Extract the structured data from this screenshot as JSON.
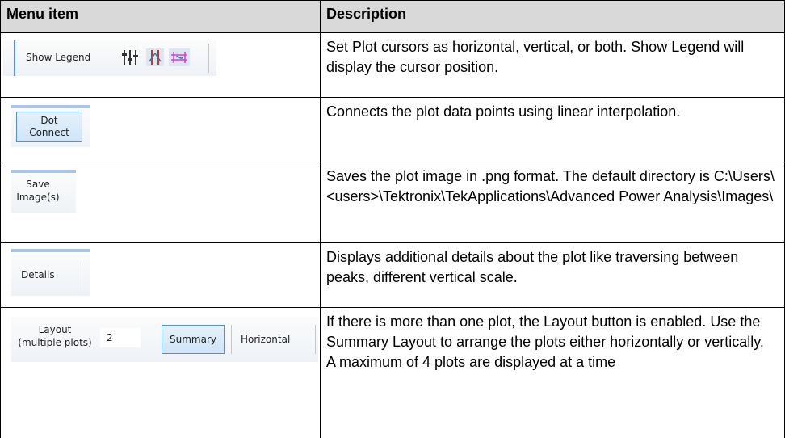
{
  "table": {
    "headers": {
      "menu_item": "Menu item",
      "description": "Description"
    },
    "rows": [
      {
        "ui": {
          "show_legend": "Show Legend"
        },
        "description": "Set Plot cursors as horizontal, vertical, or both. Show Legend will display the cursor position."
      },
      {
        "ui": {
          "dot": "Dot",
          "connect": "Connect"
        },
        "description": "Connects the plot data points using linear interpolation."
      },
      {
        "ui": {
          "save": "Save",
          "image": "Image(s)"
        },
        "description": "Saves the plot image in .png format. The default directory is C:\\Users\\<users>\\Tektronix\\TekApplications\\Advanced Power Analysis\\Images\\"
      },
      {
        "ui": {
          "details": "Details"
        },
        "description": "Displays additional details about the plot like traversing between peaks, different vertical scale."
      },
      {
        "ui": {
          "layout": "Layout",
          "multiple": "(multiple plots)",
          "count": "2",
          "summary": "Summary",
          "horizontal": "Horizontal"
        },
        "description": "If there is more than one plot, the Layout button is enabled. Use the Summary Layout to arrange the plots either horizontally or vertically. A maximum of 4 plots are displayed at a time"
      }
    ]
  },
  "colors": {
    "header_bg": "#d9d9d9",
    "selected_button": "#cfe4f7",
    "selected_border": "#4f92d6"
  }
}
